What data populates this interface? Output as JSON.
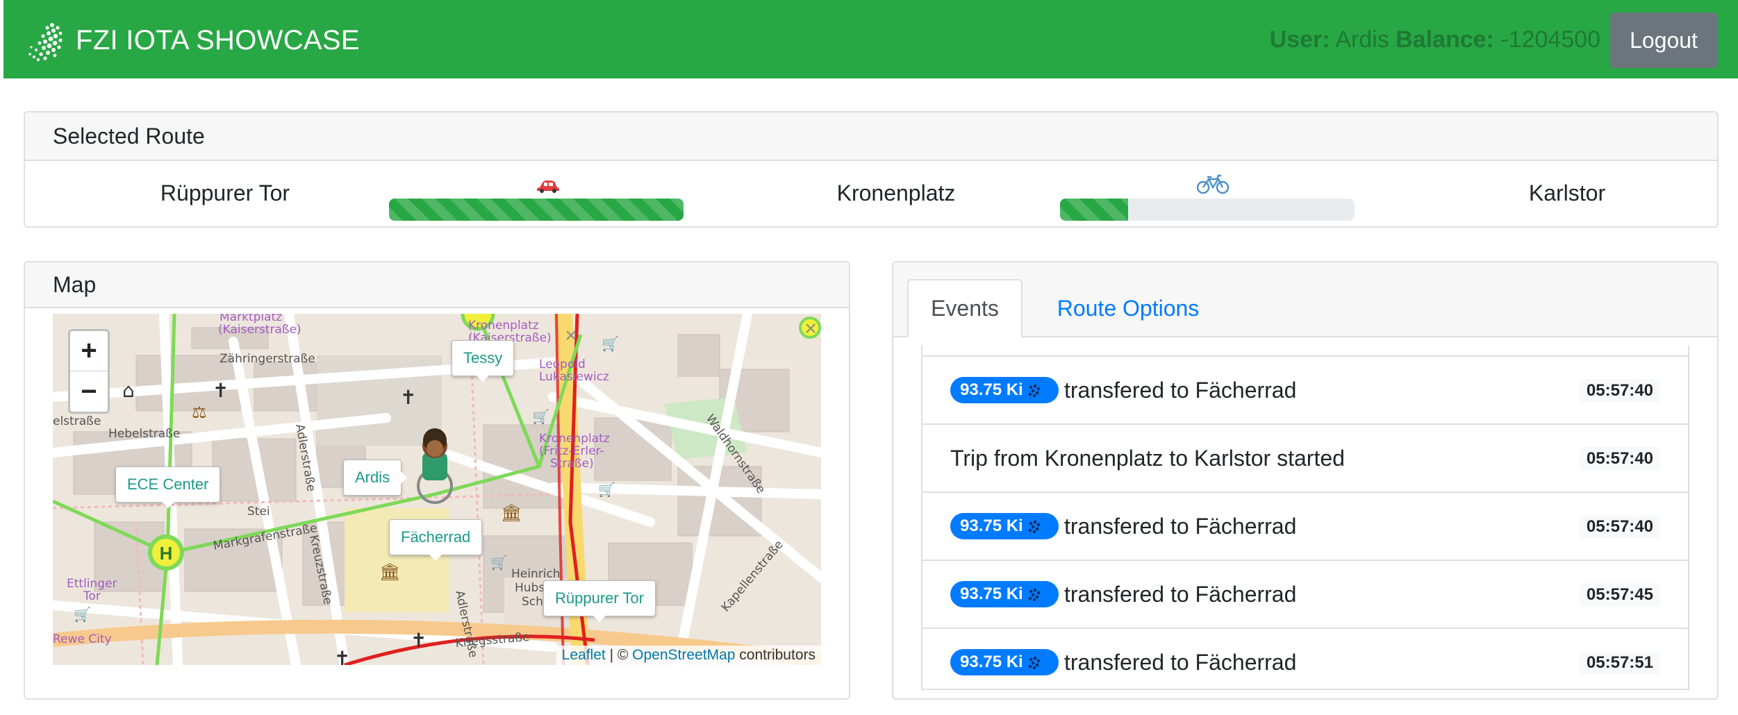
{
  "navbar": {
    "brand": "FZI IOTA SHOWCASE",
    "user_label": "User:",
    "user_name": "Ardis",
    "balance_label": "Balance:",
    "balance_value": "-1204500",
    "logout_label": "Logout",
    "color": "#28a745"
  },
  "route": {
    "header": "Selected Route",
    "stops": [
      "Rüppurer Tor",
      "Kronenplatz",
      "Karlstor"
    ],
    "legs": [
      {
        "icon": "car-icon",
        "progress": 1.0
      },
      {
        "icon": "bicycle-icon",
        "progress": 0.23
      }
    ]
  },
  "map": {
    "header": "Map",
    "zoom_in": "+",
    "zoom_out": "−",
    "markers": [
      "Tessy",
      "Ardis",
      "ECE Center",
      "Fächerrad",
      "Rüppurer Tor"
    ],
    "streets": [
      "Zähringerstraße",
      "Hebelstraße",
      "Kreuzstraße",
      "Adlerstraße",
      "Waldhornstraße",
      "Kapellenstraße",
      "Kriegsstraße",
      "Markgrafenstraße",
      "Kronenplatz (Fritz-Erler-Straße)",
      "Marktplatz (Kaiserstraße)",
      "Ettlinger Tor",
      "Rewe City",
      "Kronenplatz (Kaiserstraße)",
      "Leopold Lukasiewicz"
    ],
    "attribution_leaflet": "Leaflet",
    "attribution_sep": " | © ",
    "attribution_osm": "OpenStreetMap",
    "attribution_tail": " contributors"
  },
  "events": {
    "tabs": [
      "Events",
      "Route Options"
    ],
    "items": [
      {
        "amount": "93.75 Ki",
        "text": "transfered to Fächerrad",
        "time": "05:57:40"
      },
      {
        "amount": "",
        "text": "Trip from Kronenplatz to Karlstor started",
        "time": "05:57:40"
      },
      {
        "amount": "93.75 Ki",
        "text": "transfered to Fächerrad",
        "time": "05:57:40"
      },
      {
        "amount": "93.75 Ki",
        "text": "transfered to Fächerrad",
        "time": "05:57:45"
      },
      {
        "amount": "93.75 Ki",
        "text": "transfered to Fächerrad",
        "time": "05:57:51"
      }
    ]
  }
}
